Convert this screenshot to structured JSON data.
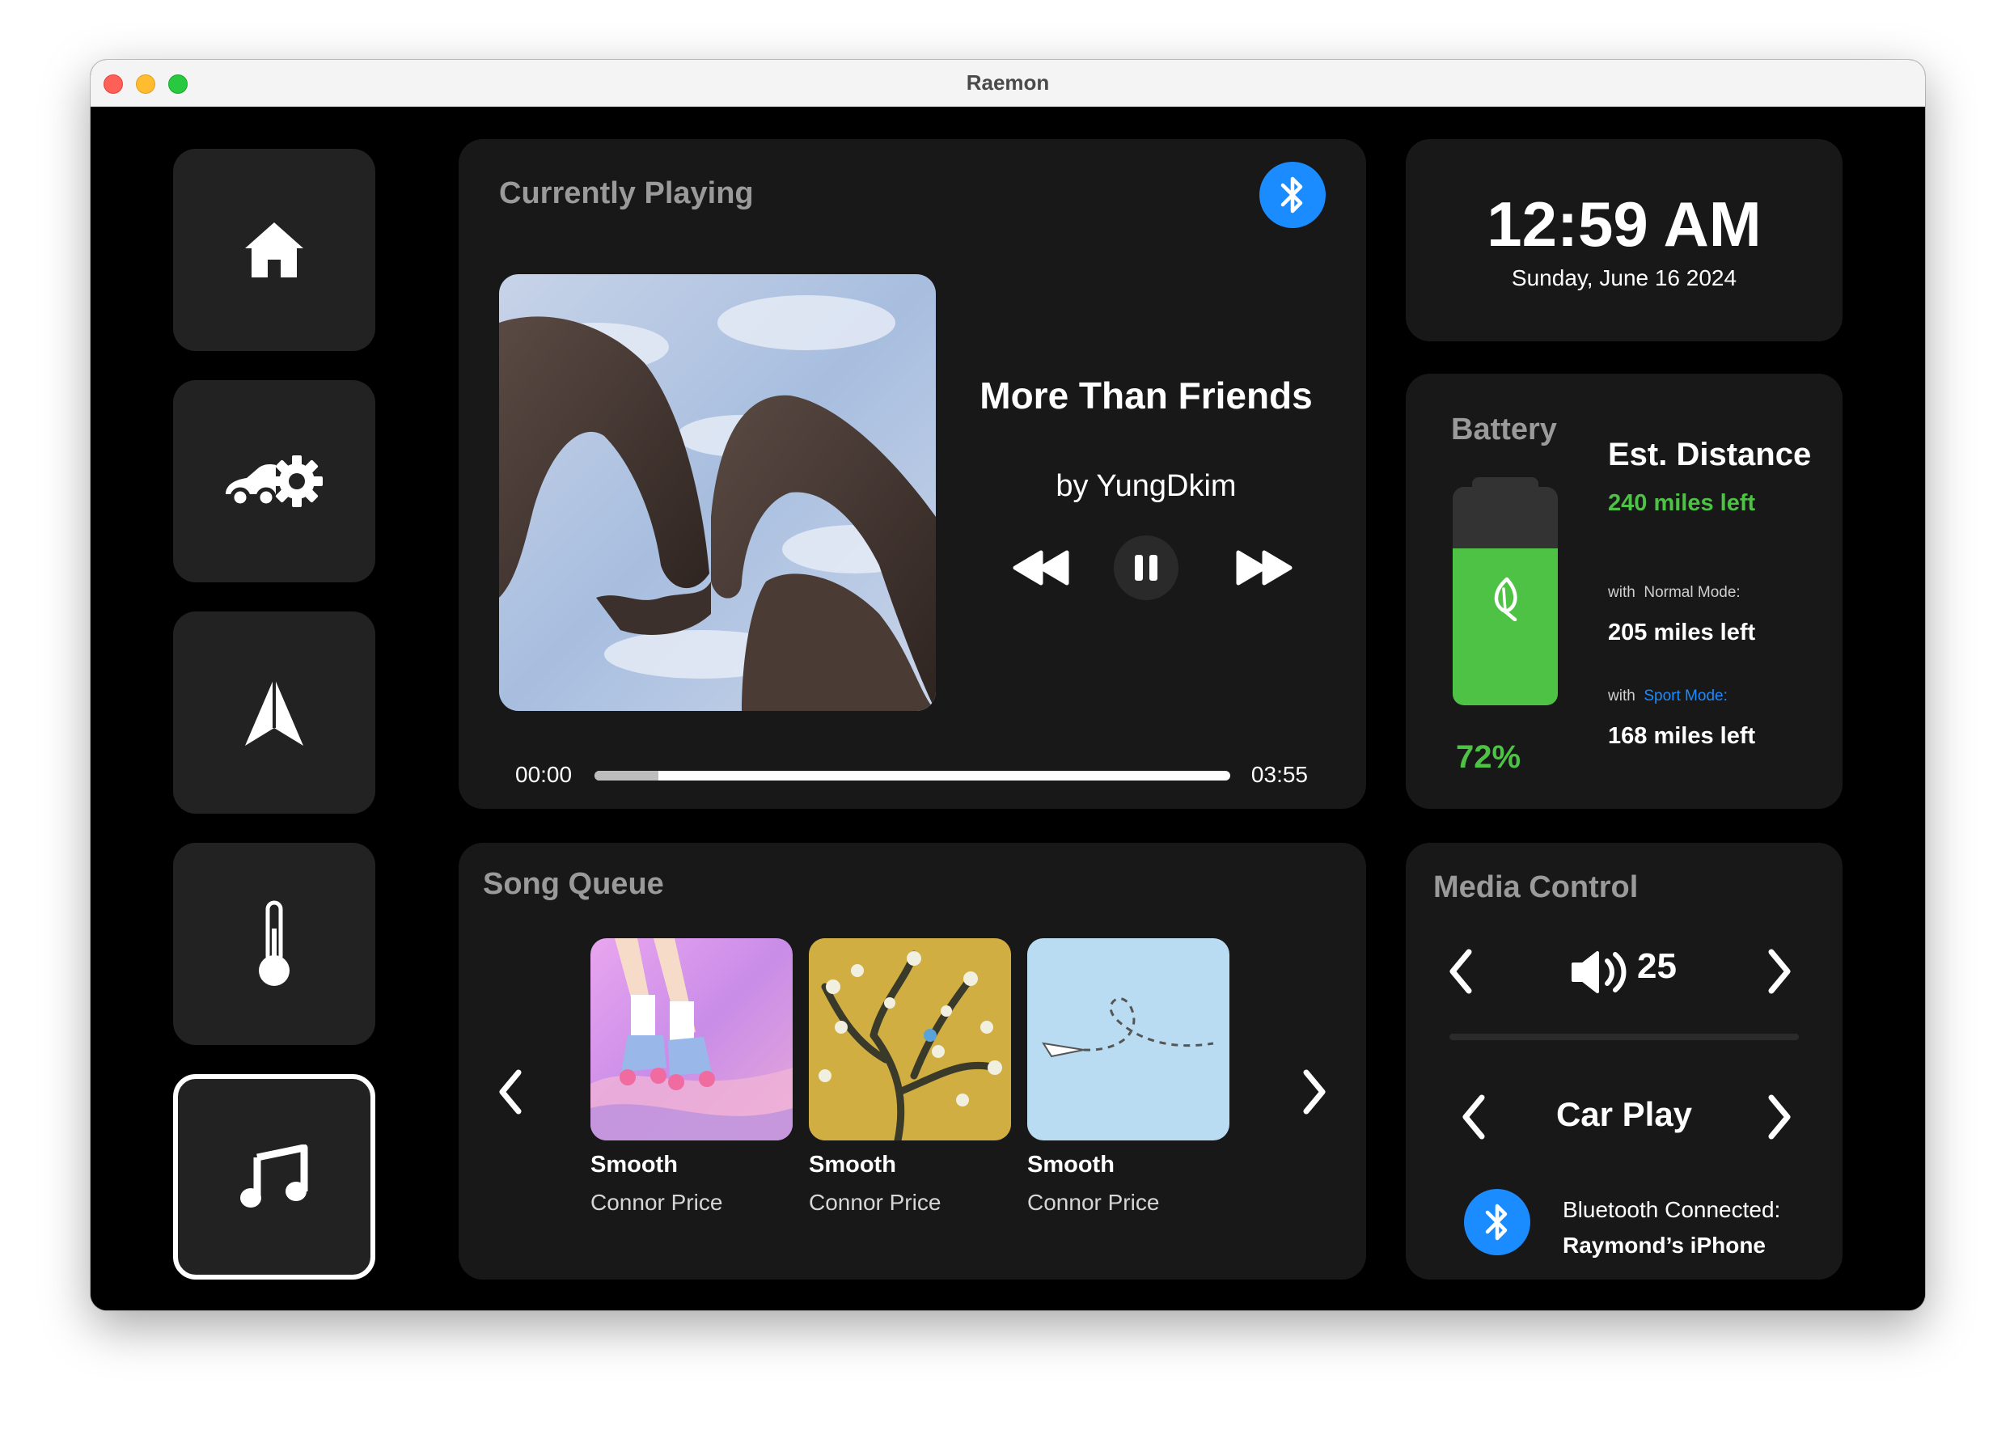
{
  "window": {
    "title": "Raemon"
  },
  "sidebar": {
    "items": [
      {
        "name": "home",
        "icon": "home-icon",
        "active": false
      },
      {
        "name": "car-settings",
        "icon": "car-gear-icon",
        "active": false
      },
      {
        "name": "navigation",
        "icon": "navigation-arrow-icon",
        "active": false
      },
      {
        "name": "climate",
        "icon": "thermometer-icon",
        "active": false
      },
      {
        "name": "music",
        "icon": "music-note-icon",
        "active": true
      }
    ]
  },
  "now_playing": {
    "heading": "Currently Playing",
    "title": "More Than Friends",
    "artist": "by YungDkim",
    "elapsed": "00:00",
    "duration": "03:55",
    "progress": 0.1,
    "controls": {
      "prev": "rewind-icon",
      "play_pause": "pause-icon",
      "next": "fast-forward-icon"
    },
    "bluetooth_icon": "bluetooth-icon",
    "album_art": "album-art-heart-hands"
  },
  "clock": {
    "time": "12:59 AM",
    "date": "Sunday, June 16 2024"
  },
  "battery": {
    "heading": "Battery",
    "percent_label": "72%",
    "percent": 0.72,
    "icon": "leaf-icon",
    "est_title": "Est. Distance",
    "est_value": "240 miles left",
    "normal_prefix": "with",
    "normal_mode": "Normal Mode:",
    "normal_value": "205 miles left",
    "sport_prefix": "with",
    "sport_mode": "Sport Mode:",
    "sport_value": "168 miles left",
    "colors": {
      "fill": "#4dc244",
      "sport": "#1a8cff"
    }
  },
  "queue": {
    "heading": "Song Queue",
    "items": [
      {
        "title": "Smooth",
        "artist": "Connor Price",
        "art": "roller-skates-art"
      },
      {
        "title": "Smooth",
        "artist": "Connor Price",
        "art": "almond-blossom-art"
      },
      {
        "title": "Smooth",
        "artist": "Connor Price",
        "art": "paper-plane-art"
      }
    ]
  },
  "media_control": {
    "heading": "Media Control",
    "volume": "25",
    "volume_icon": "speaker-icon",
    "source": "Car Play",
    "bt_label": "Bluetooth Connected:",
    "bt_device": "Raymond’s iPhone"
  },
  "colors": {
    "accent": "#1a8cff",
    "green": "#4dc244",
    "card": "#181818",
    "nav": "#222222"
  }
}
